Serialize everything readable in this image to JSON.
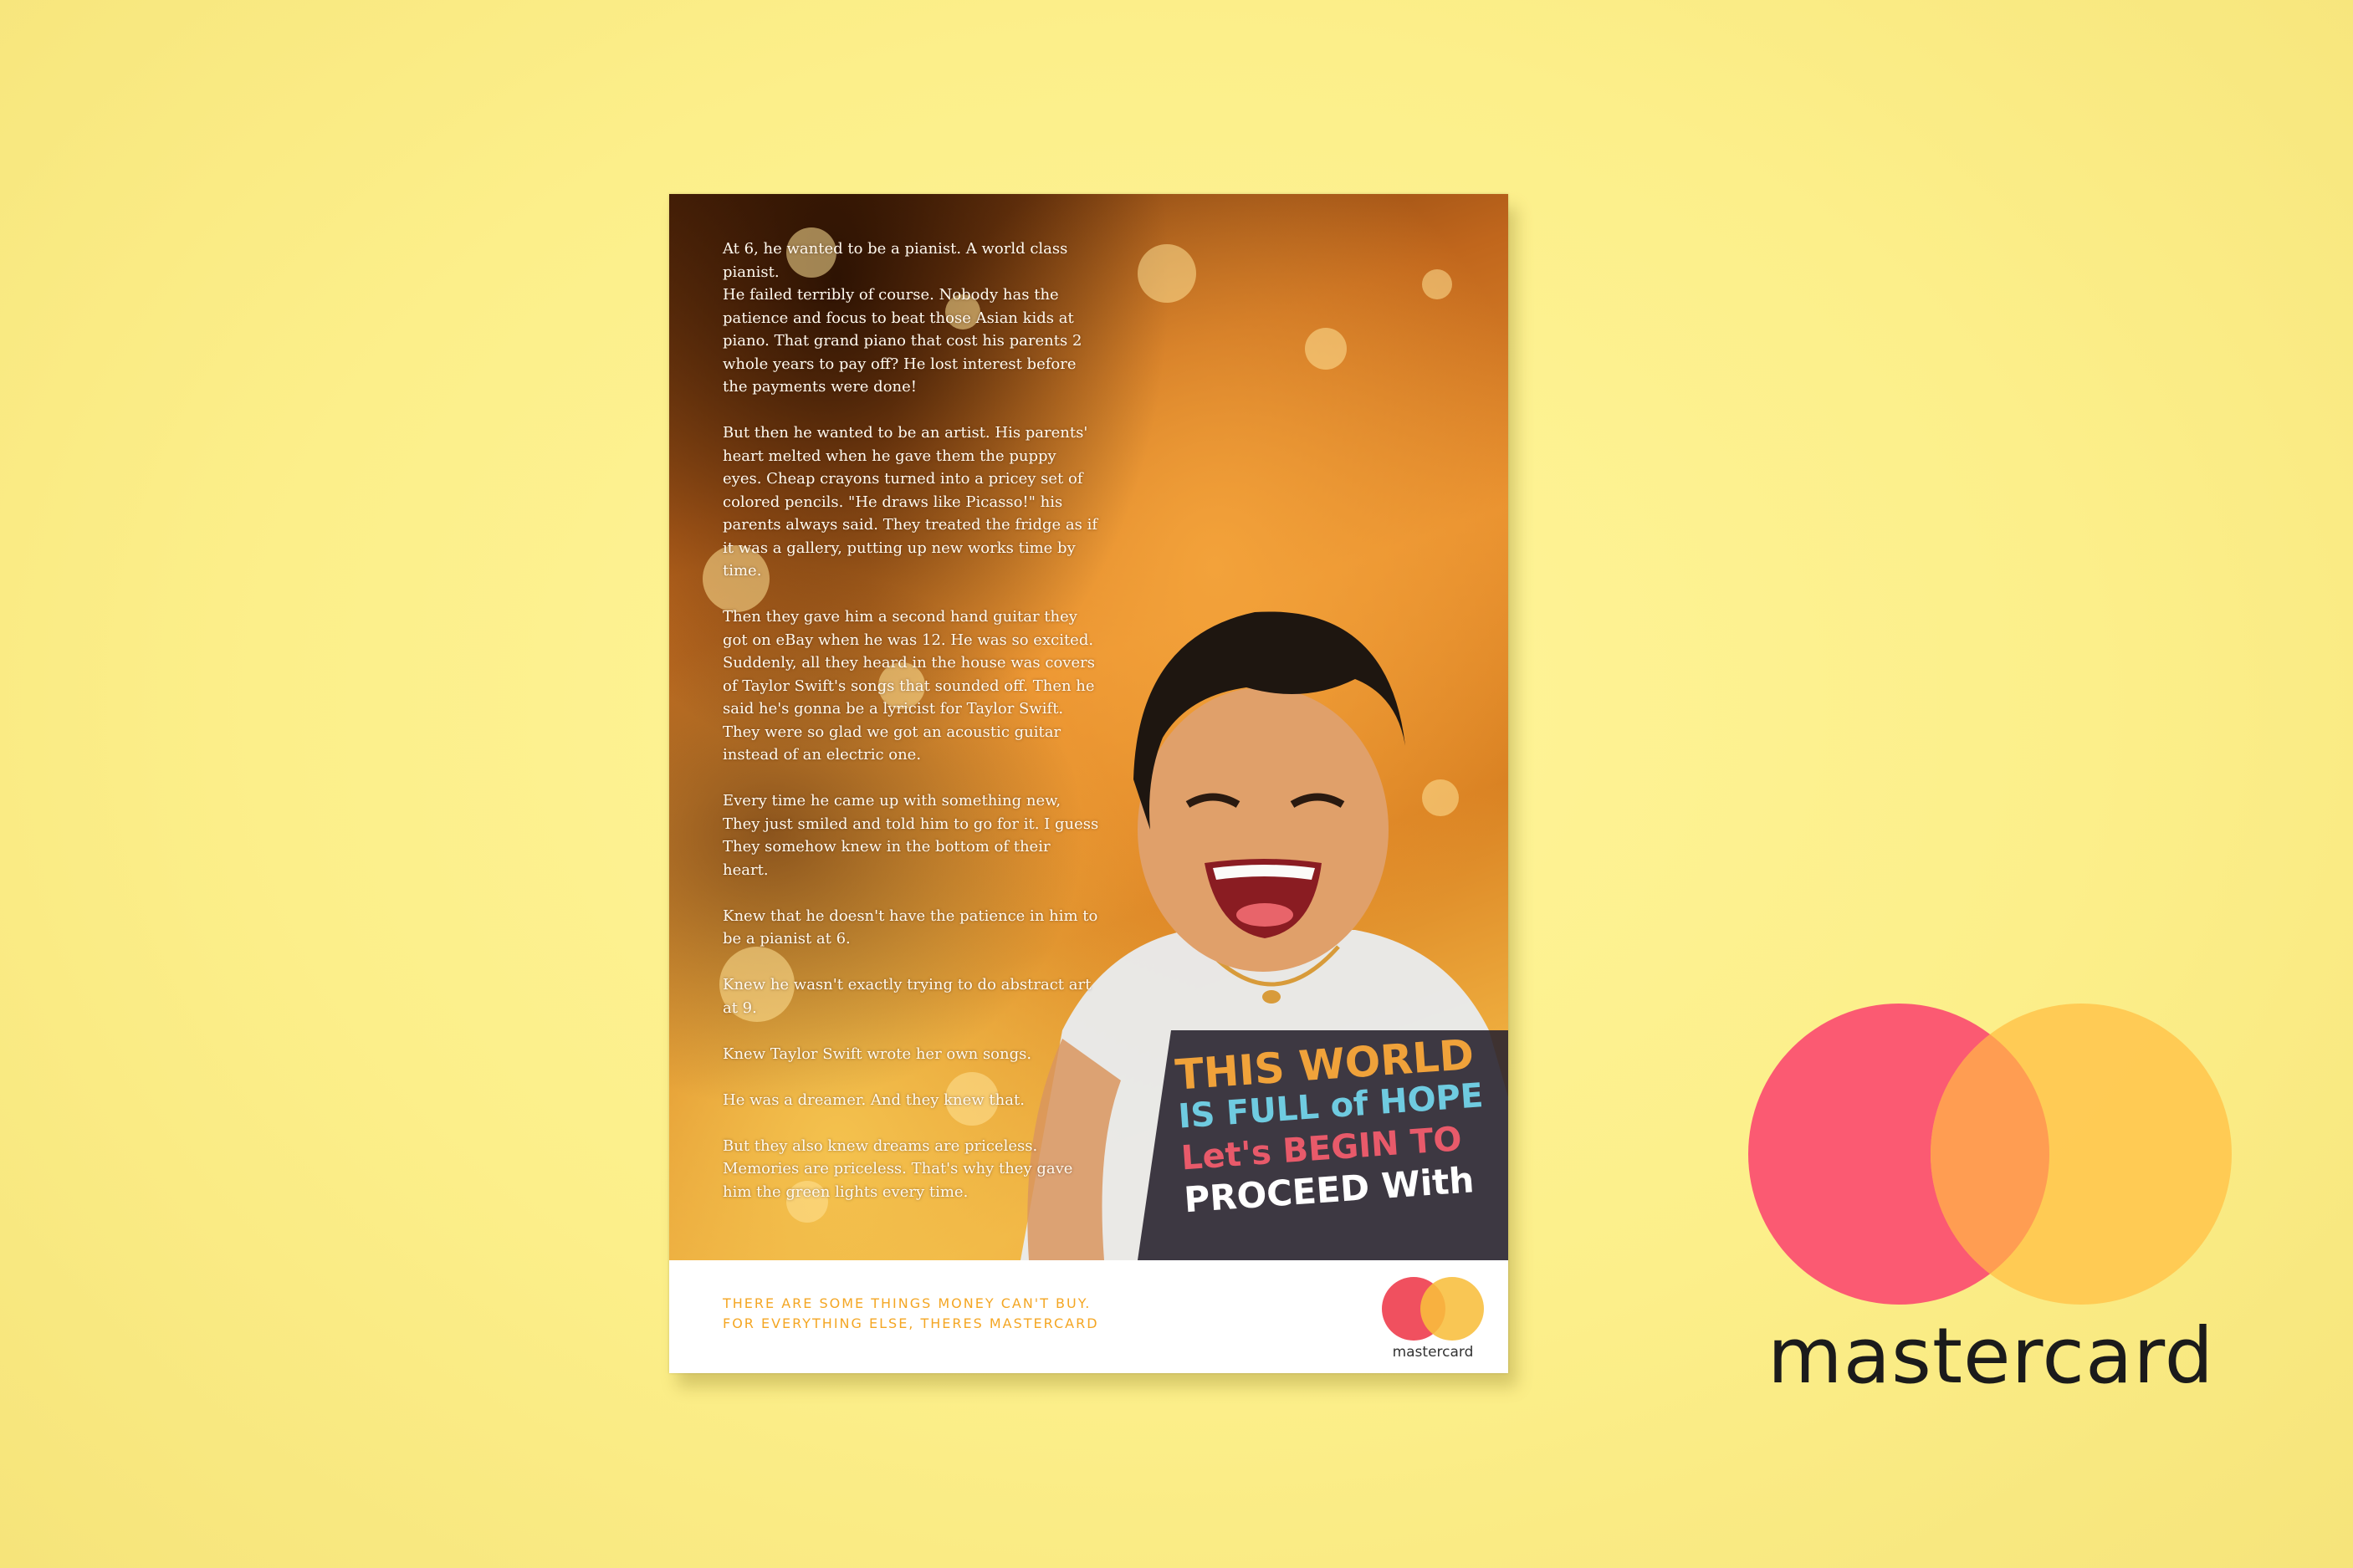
{
  "colors": {
    "background": "#fcf08c",
    "tagline": "#f4a623",
    "logo_red": "#fb5a72",
    "logo_yellow": "#ffc850",
    "logo_overlap": "#ff9d52"
  },
  "ad": {
    "paragraphs": [
      "At 6, he wanted to be a pianist. A world class pianist.\nHe failed terribly of course. Nobody has the patience and focus to beat those Asian kids at piano. That grand piano that cost his parents 2 whole years to pay off? He lost interest before the payments were done!",
      "But then he wanted to be an artist. His parents' heart melted when he gave them the puppy eyes. Cheap crayons turned into a pricey set of colored pencils. \"He draws like Picasso!\" his parents always said. They treated the fridge as if it was a gallery, putting up new works time by time.",
      "Then they gave him a second hand guitar they got on eBay when he was 12. He was so excited. Suddenly, all they heard in the house was covers of Taylor Swift's songs that sounded off. Then he said he's gonna be a lyricist for Taylor Swift. They were so glad we got an acoustic guitar instead of an electric one.",
      "Every time he came up with something new, They just smiled and told him to go for it.  I guess They somehow knew in the bottom of their heart.",
      "Knew that he doesn't have the patience in him to be a pianist at 6.",
      "Knew he wasn't exactly trying to do abstract art at 9.",
      "Knew Taylor Swift wrote her own songs.",
      "He was a dreamer. And they knew that.",
      "But they also knew dreams are priceless. Memories are priceless. That's why they gave him the green lights every time."
    ],
    "tagline": {
      "line1": "THERE ARE SOME THINGS MONEY CAN'T BUY.",
      "line2": "FOR EVERYTHING ELSE, THERES MASTERCARD"
    },
    "logo_word": "mastercard",
    "shirt_text": [
      "THIS WORLD",
      "IS FULL of HOPE",
      "Let's BEGIN TO",
      "PROCEED With"
    ]
  },
  "brand": {
    "logo_word": "mastercard"
  }
}
